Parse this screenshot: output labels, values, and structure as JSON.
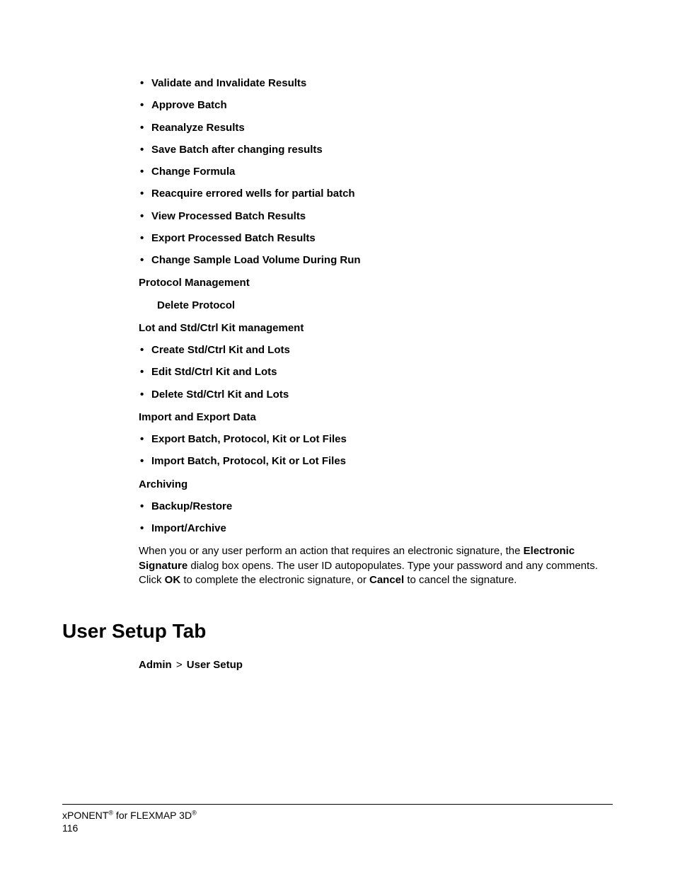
{
  "list1": [
    "Validate and Invalidate Results",
    "Approve Batch",
    "Reanalyze Results",
    "Save Batch after changing results",
    "Change Formula",
    "Reacquire errored wells for partial batch",
    "View Processed Batch Results",
    "Export Processed Batch Results",
    "Change Sample Load Volume During Run"
  ],
  "protocol_mgmt": "Protocol Management",
  "delete_protocol": "Delete Protocol",
  "lot_mgmt": "Lot and Std/Ctrl Kit management",
  "list2": [
    "Create Std/Ctrl Kit and Lots",
    "Edit Std/Ctrl Kit and Lots",
    "Delete Std/Ctrl Kit and Lots"
  ],
  "import_export": "Import and Export Data",
  "list3": [
    "Export Batch, Protocol, Kit or Lot Files",
    "Import Batch, Protocol, Kit or Lot Files"
  ],
  "archiving": "Archiving",
  "list4": [
    "Backup/Restore",
    "Import/Archive"
  ],
  "para": {
    "t1": "When you or any user perform an action that requires an electronic signature, the ",
    "b1": "Electronic Signature",
    "t2": " dialog box opens. The user ID autopopulates. Type your password and any comments. Click ",
    "b2": "OK",
    "t3": " to complete the electronic signature, or ",
    "b3": "Cancel",
    "t4": " to cancel the signature."
  },
  "heading": "User Setup Tab",
  "breadcrumb": {
    "a": "Admin",
    "sep": ">",
    "b": "User Setup"
  },
  "footer": {
    "product1": "xPONENT",
    "mid": " for FLEXMAP 3D",
    "reg": "®",
    "page": "116"
  }
}
